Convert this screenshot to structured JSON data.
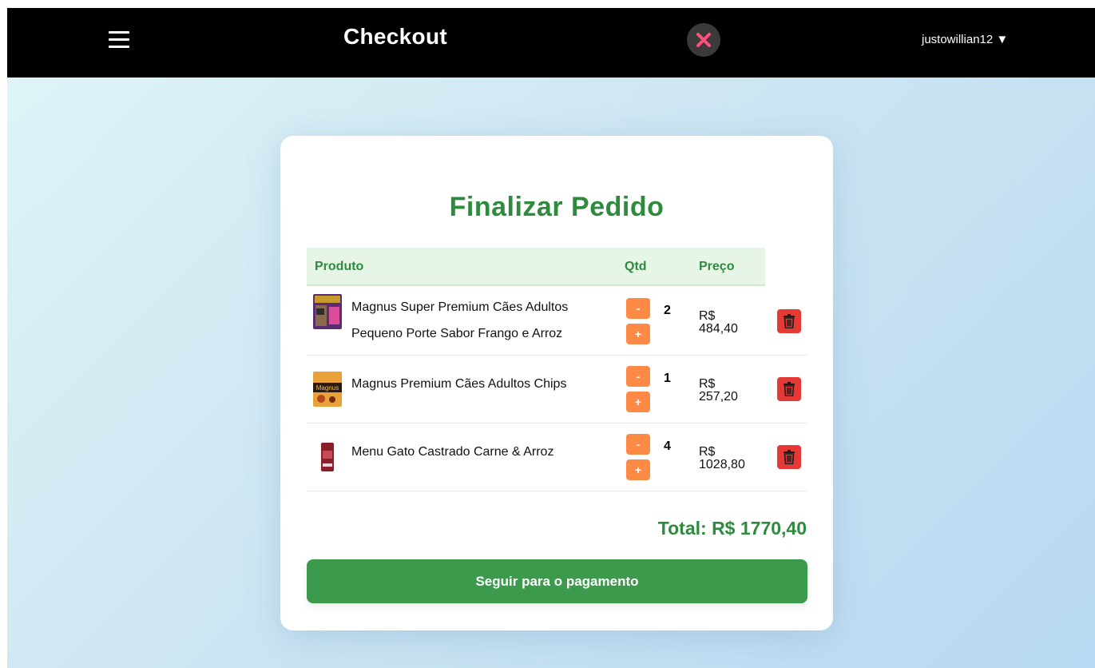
{
  "header": {
    "title": "Checkout",
    "menu_icon": "hamburger-menu-icon",
    "close_icon": "close-x-icon",
    "username": "justowillian12",
    "dropdown_glyph": "▼"
  },
  "card": {
    "title": "Finalizar Pedido",
    "columns": {
      "product": "Produto",
      "qty": "Qtd",
      "price": "Preço"
    },
    "items": [
      {
        "name": "Magnus Super Premium Cães Adultos Pequeno Porte Sabor Frango e Arroz",
        "qty": "2",
        "price_currency": "R$",
        "price_value": "484,40",
        "minus": "-",
        "plus": "+"
      },
      {
        "name": "Magnus Premium Cães Adultos Chips",
        "qty": "1",
        "price_currency": "R$",
        "price_value": "257,20",
        "minus": "-",
        "plus": "+"
      },
      {
        "name": "Menu Gato Castrado Carne & Arroz",
        "qty": "4",
        "price_currency": "R$",
        "price_value": "1028,80",
        "minus": "-",
        "plus": "+"
      }
    ],
    "total": "Total: R$ 1770,40",
    "pay_button": "Seguir para o pagamento"
  },
  "colors": {
    "accent_green": "#2e8b3e",
    "button_green": "#3b9a4c",
    "qty_orange": "#ff8a45",
    "delete_red": "#e53935",
    "header_bg": "#000000"
  }
}
